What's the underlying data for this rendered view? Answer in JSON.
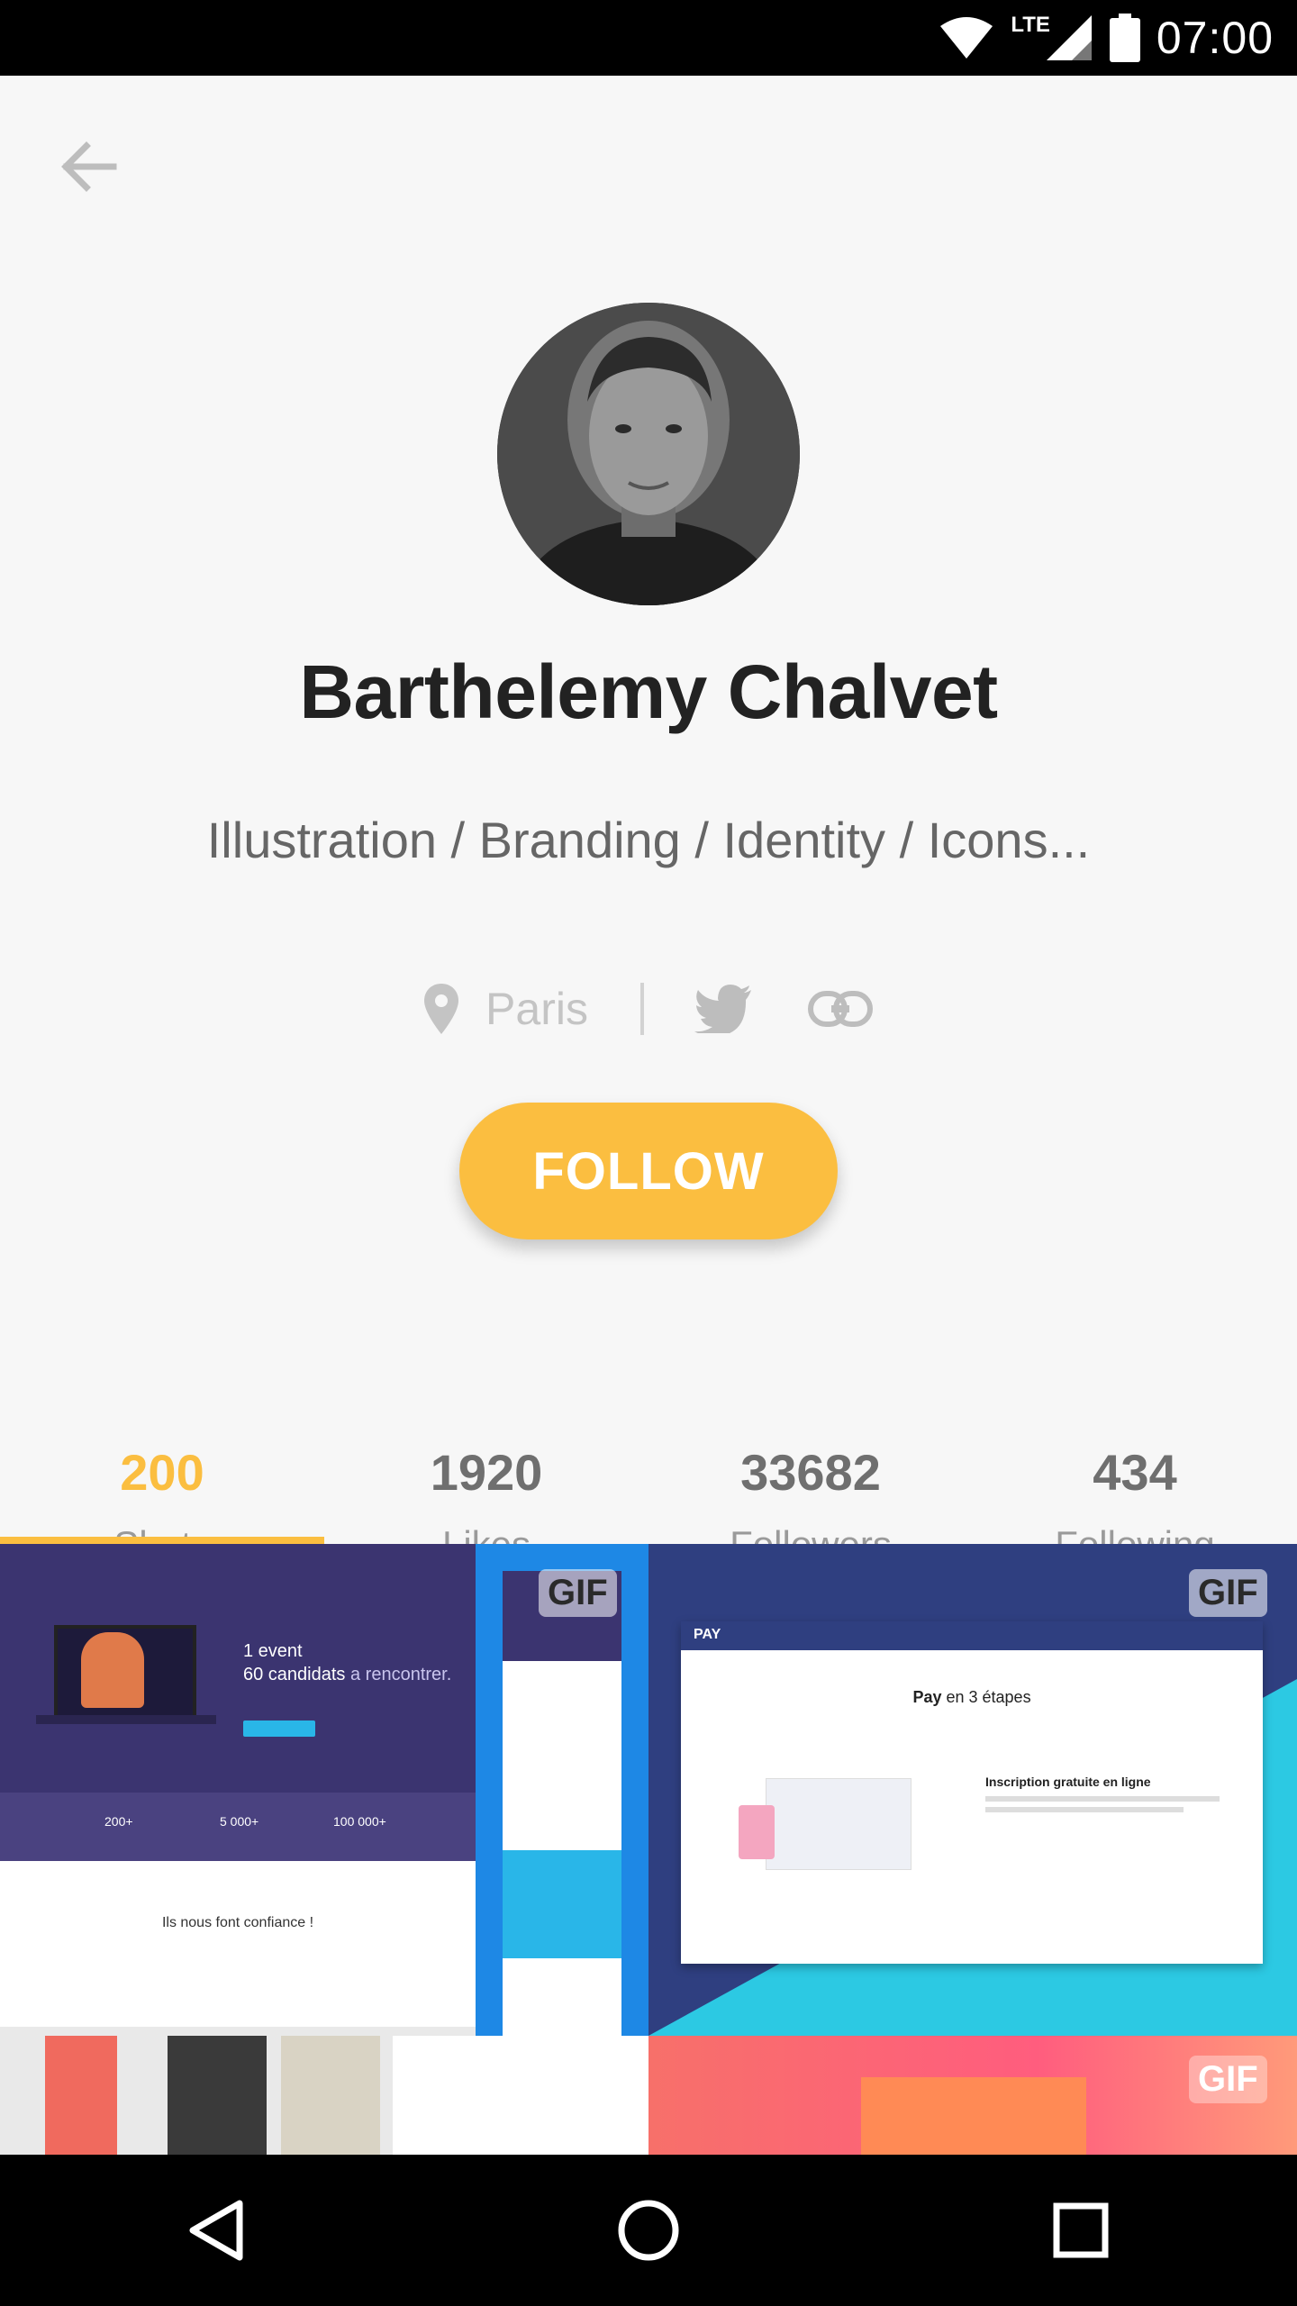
{
  "status_bar": {
    "network": "LTE",
    "time": "07:00"
  },
  "profile": {
    "name": "Barthelemy Chalvet",
    "tagline": "Illustration / Branding / Identity / Icons...",
    "location": "Paris",
    "follow_label": "FOLLOW"
  },
  "stats": [
    {
      "value": "200",
      "label": "Shots"
    },
    {
      "value": "1920",
      "label": "Likes"
    },
    {
      "value": "33682",
      "label": "Followers"
    },
    {
      "value": "434",
      "label": "Following"
    }
  ],
  "shots": {
    "gif_label": "GIF",
    "shot1": {
      "headline_1": "1 event",
      "headline_2": "60 candidats",
      "headline_3": "a rencontrer.",
      "stat_1": "200+",
      "stat_2": "5 000+",
      "stat_3": "100 000+",
      "trust": "Ils nous font confiance !"
    },
    "shot3": {
      "brand": "PAY",
      "title_bold": "Pay",
      "title_rest": "en 3 étapes",
      "section": "Inscription gratuite en ligne"
    }
  },
  "colors": {
    "accent": "#fbbe40",
    "status_bar": "#000000"
  }
}
